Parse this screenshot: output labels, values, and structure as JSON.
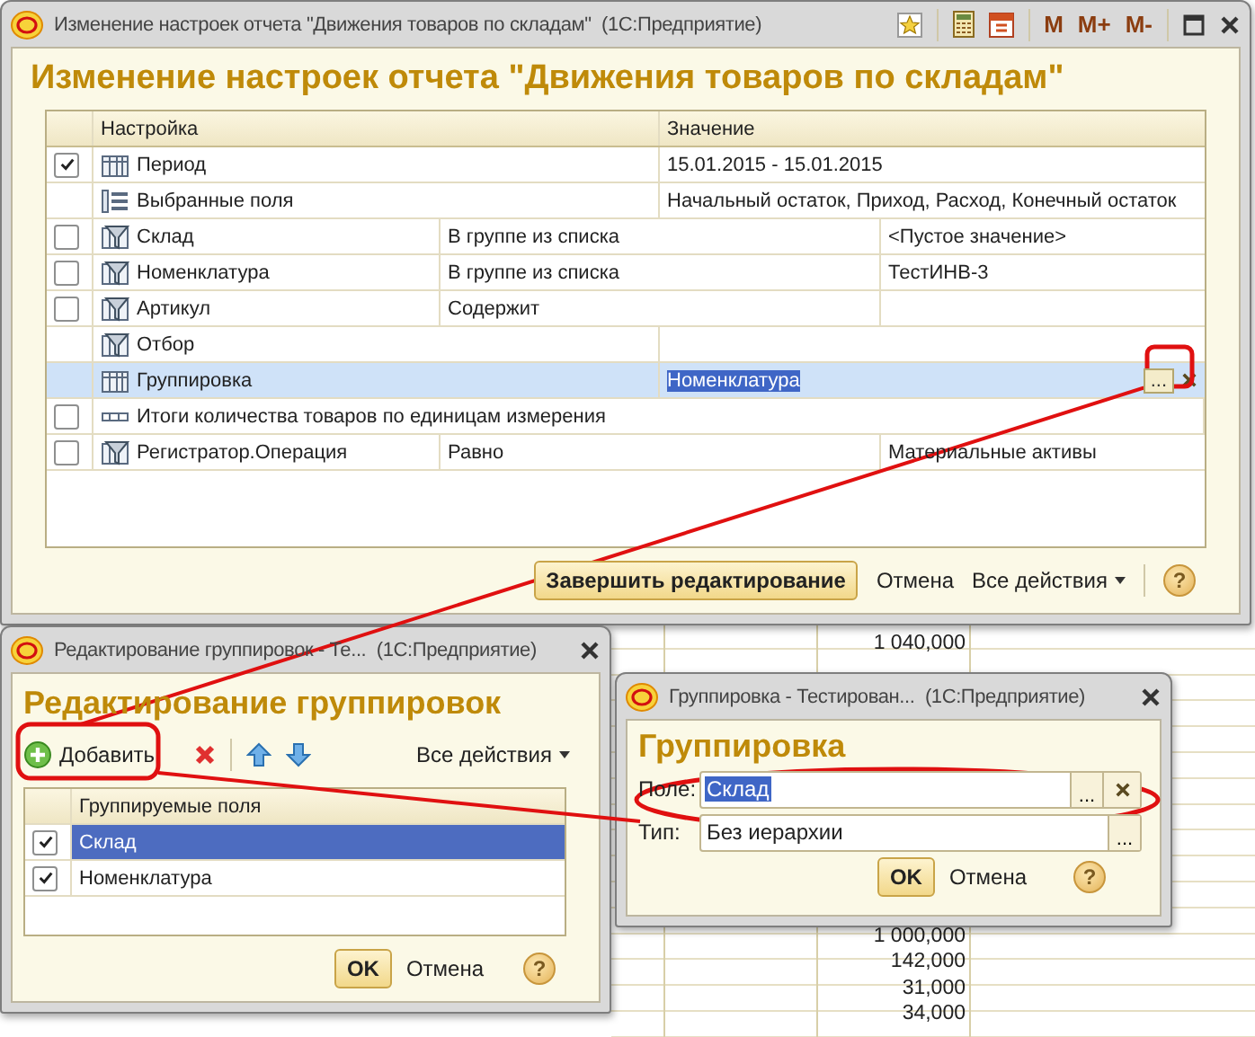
{
  "report_background": {
    "upper_cells": [
      "1 040,000"
    ],
    "lower_cells": [
      "1 000,000",
      "142,000",
      "31,000",
      "34,000"
    ]
  },
  "settings_window": {
    "title": "Изменение настроек отчета \"Движения товаров по складам\"  (1С:Предприятие)",
    "title_buttons": [
      "M",
      "M+",
      "M-"
    ],
    "heading": "Изменение настроек отчета \"Движения товаров по складам\"",
    "columns": [
      "Настройка",
      "Значение"
    ],
    "rows": [
      {
        "kind": "parameter",
        "name": "Период",
        "checked": true,
        "value": "15.01.2015 - 15.01.2015",
        "selected": false
      },
      {
        "kind": "fields",
        "name": "Выбранные поля",
        "value": "Начальный остаток, Приход, Расход, Конечный остаток",
        "selected": false
      },
      {
        "kind": "filter",
        "name": "Склад",
        "checked": false,
        "condition": "В группе из списка",
        "value": "<Пустое значение>",
        "selected": false
      },
      {
        "kind": "filter",
        "name": "Номенклатура",
        "checked": false,
        "condition": "В группе из списка",
        "value": "ТестИНВ-3",
        "selected": false
      },
      {
        "kind": "filter",
        "name": "Артикул",
        "checked": false,
        "condition": "Содержит",
        "selected": false
      },
      {
        "kind": "filter_group",
        "name": "Отбор",
        "selected": false
      },
      {
        "kind": "grouping",
        "name": "Группировка",
        "value": "Номенклатура",
        "choice_button": "...",
        "selected": true
      },
      {
        "kind": "option",
        "name": "Итоги количества товаров по единицам измерения",
        "checked": false,
        "selected": false
      },
      {
        "kind": "filter",
        "name": "Регистратор.Операция",
        "checked": false,
        "condition": "Равно",
        "value": "Материальные активы",
        "selected": false
      }
    ],
    "buttons": [
      {
        "kind": "default",
        "label": "Завершить редактирование"
      },
      {
        "kind": "plain",
        "label": "Отмена"
      },
      {
        "kind": "menu",
        "label": "Все действия"
      }
    ],
    "help": "?"
  },
  "groupings_window": {
    "title": "Редактирование группировок - Те...  (1С:Предприятие)",
    "heading": "Редактирование группировок",
    "add_button": "Добавить",
    "actions_menu": "Все действия",
    "column": "Группируемые поля",
    "rows": [
      {
        "label": "Склад",
        "checked": true,
        "selected": true
      },
      {
        "label": "Номенклатура",
        "checked": true,
        "selected": false
      }
    ],
    "ok": "OK",
    "cancel": "Отмена",
    "help": "?"
  },
  "grouping_window": {
    "title": "Группировка - Тестирован...  (1С:Предприятие)",
    "heading": "Группировка",
    "fields": [
      {
        "label": "Поле:",
        "value": "Склад",
        "choice_button": "...",
        "value_selected": true,
        "clearable": true
      },
      {
        "label": "Тип:",
        "value": "Без иерархии",
        "choice_button": "...",
        "value_selected": false,
        "clearable": false
      }
    ],
    "ok": "OK",
    "cancel": "Отмена",
    "help": "?"
  }
}
